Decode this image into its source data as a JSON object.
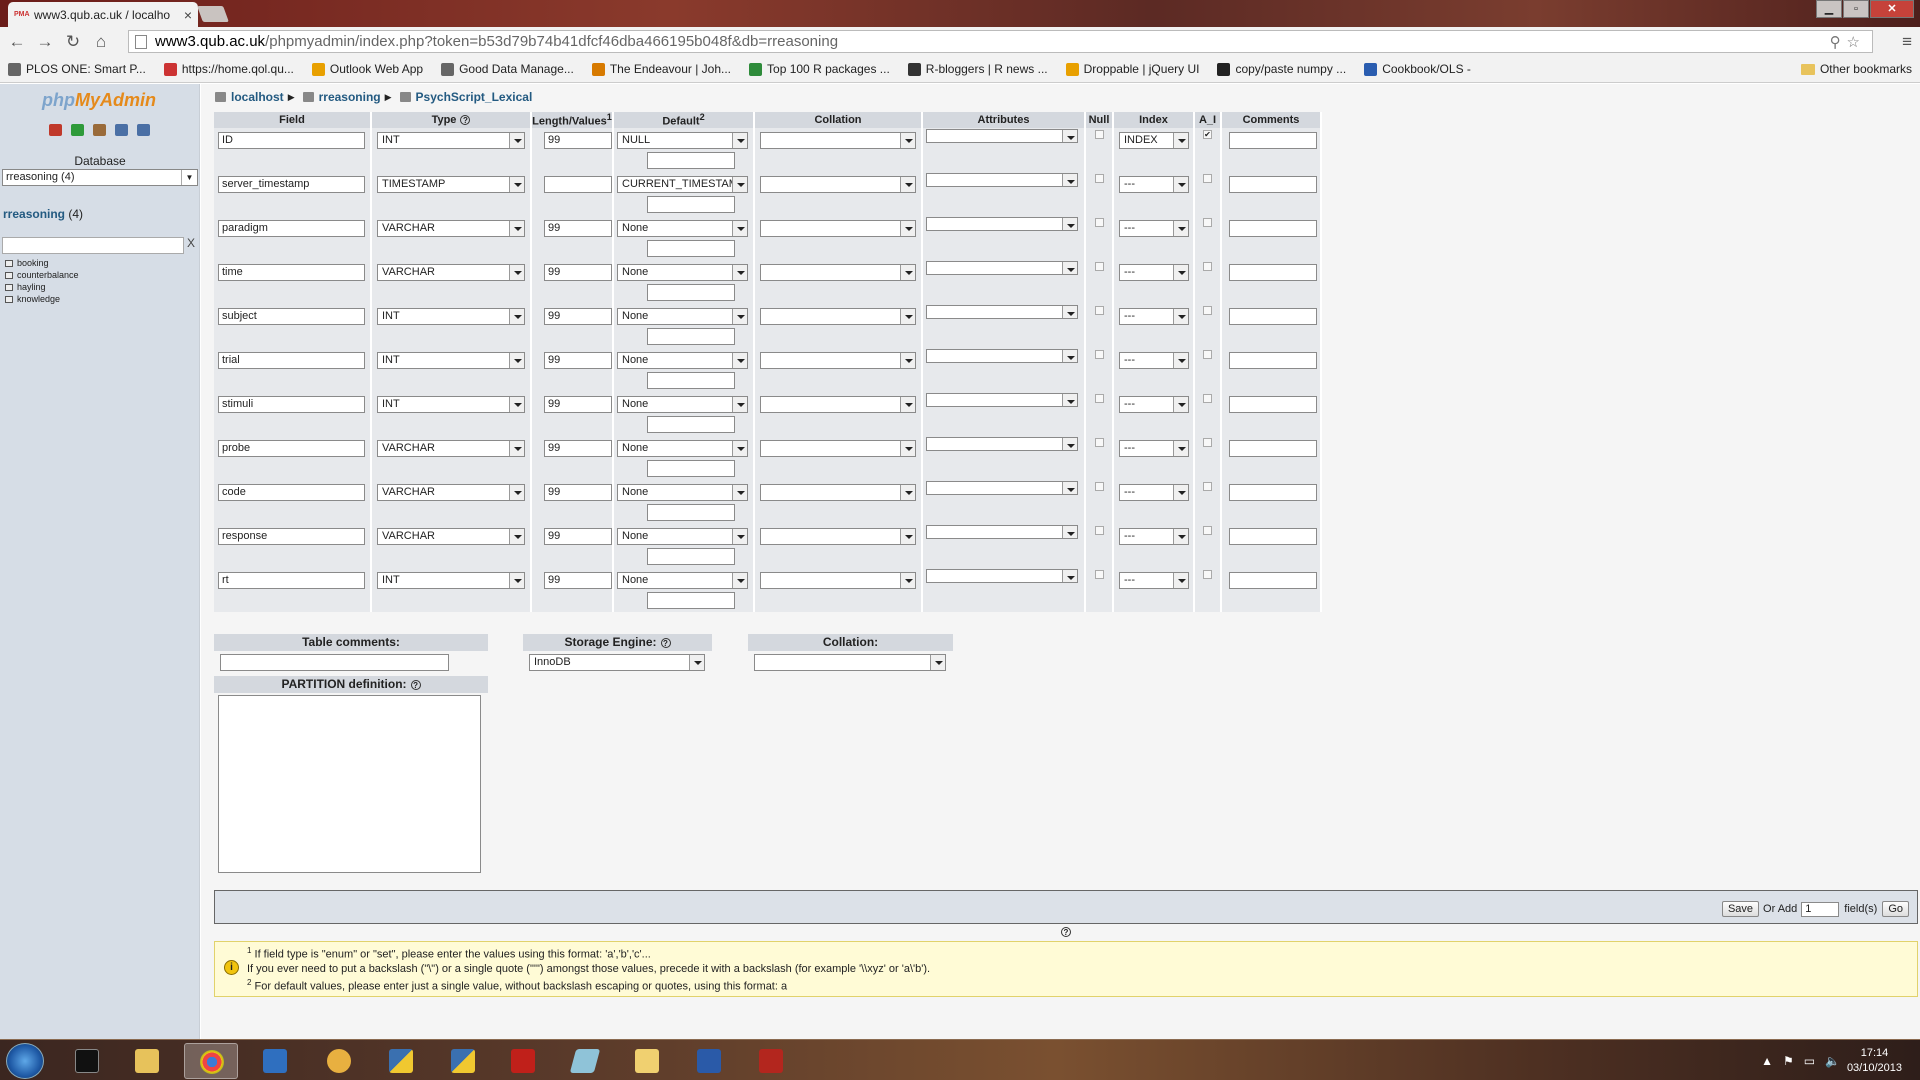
{
  "browser": {
    "tab_title": "www3.qub.ac.uk / localho",
    "url_host": "www3.qub.ac.uk",
    "url_rest": "/phpmyadmin/index.php?token=b53d79b74b41dfcf46dba466195b048f&db=rreasoning",
    "bookmarks": [
      {
        "label": "PLOS ONE: Smart P...",
        "color": "#666"
      },
      {
        "label": "https://home.qol.qu...",
        "color": "#c33"
      },
      {
        "label": "Outlook Web App",
        "color": "#e8a000"
      },
      {
        "label": "Good Data Manage...",
        "color": "#666"
      },
      {
        "label": "The Endeavour | Joh...",
        "color": "#d77a00"
      },
      {
        "label": "Top 100 R packages ...",
        "color": "#2e8b3a"
      },
      {
        "label": "R-bloggers | R news ...",
        "color": "#333"
      },
      {
        "label": "Droppable | jQuery UI",
        "color": "#e8a000"
      },
      {
        "label": "copy/paste numpy ...",
        "color": "#222"
      },
      {
        "label": "Cookbook/OLS -",
        "color": "#2a5db0"
      }
    ],
    "other_bookmarks": "Other bookmarks"
  },
  "sidebar": {
    "logo_php": "php",
    "logo_myadmin": "MyAdmin",
    "database_label": "Database",
    "database_selected": "rreasoning (4)",
    "db_link_name": "rreasoning",
    "db_link_count": "(4)",
    "filter_clear": "X",
    "tables": [
      "booking",
      "counterbalance",
      "hayling",
      "knowledge"
    ]
  },
  "breadcrumb": {
    "server": "localhost",
    "database": "rreasoning",
    "table": "PsychScript_Lexical"
  },
  "table": {
    "headers": {
      "field": "Field",
      "type": "Type",
      "length": "Length/Values",
      "length_sup": "1",
      "default": "Default",
      "default_sup": "2",
      "collation": "Collation",
      "attributes": "Attributes",
      "null": "Null",
      "index": "Index",
      "ai": "A_I",
      "comments": "Comments"
    },
    "rows": [
      {
        "field": "ID",
        "type": "INT",
        "length": "99",
        "default": "NULL",
        "index": "INDEX",
        "ai": true
      },
      {
        "field": "server_timestamp",
        "type": "TIMESTAMP",
        "length": "",
        "default": "CURRENT_TIMESTAMP",
        "index": "---",
        "ai": false
      },
      {
        "field": "paradigm",
        "type": "VARCHAR",
        "length": "99",
        "default": "None",
        "index": "---",
        "ai": false
      },
      {
        "field": "time",
        "type": "VARCHAR",
        "length": "99",
        "default": "None",
        "index": "---",
        "ai": false
      },
      {
        "field": "subject",
        "type": "INT",
        "length": "99",
        "default": "None",
        "index": "---",
        "ai": false
      },
      {
        "field": "trial",
        "type": "INT",
        "length": "99",
        "default": "None",
        "index": "---",
        "ai": false
      },
      {
        "field": "stimuli",
        "type": "INT",
        "length": "99",
        "default": "None",
        "index": "---",
        "ai": false
      },
      {
        "field": "probe",
        "type": "VARCHAR",
        "length": "99",
        "default": "None",
        "index": "---",
        "ai": false
      },
      {
        "field": "code",
        "type": "VARCHAR",
        "length": "99",
        "default": "None",
        "index": "---",
        "ai": false
      },
      {
        "field": "response",
        "type": "VARCHAR",
        "length": "99",
        "default": "None",
        "index": "---",
        "ai": false
      },
      {
        "field": "rt",
        "type": "INT",
        "length": "99",
        "default": "None",
        "index": "---",
        "ai": false
      }
    ]
  },
  "options": {
    "table_comments_label": "Table comments:",
    "storage_engine_label": "Storage Engine:",
    "storage_engine_value": "InnoDB",
    "collation_label": "Collation:",
    "partition_label": "PARTITION definition:"
  },
  "savebar": {
    "save": "Save",
    "or_add": "Or Add",
    "add_count": "1",
    "fields": "field(s)",
    "go": "Go"
  },
  "notice": {
    "line1_sup": "1",
    "line1": "If field type is \"enum\" or \"set\", please enter the values using this format: 'a','b','c'...",
    "line2": "If you ever need to put a backslash (\"\\\") or a single quote (\"'\") amongst those values, precede it with a backslash (for example '\\\\xyz' or 'a\\'b').",
    "line3_sup": "2",
    "line3": "For default values, please enter just a single value, without backslash escaping or quotes, using this format: a"
  },
  "taskbar": {
    "time": "17:14",
    "date": "03/10/2013"
  }
}
